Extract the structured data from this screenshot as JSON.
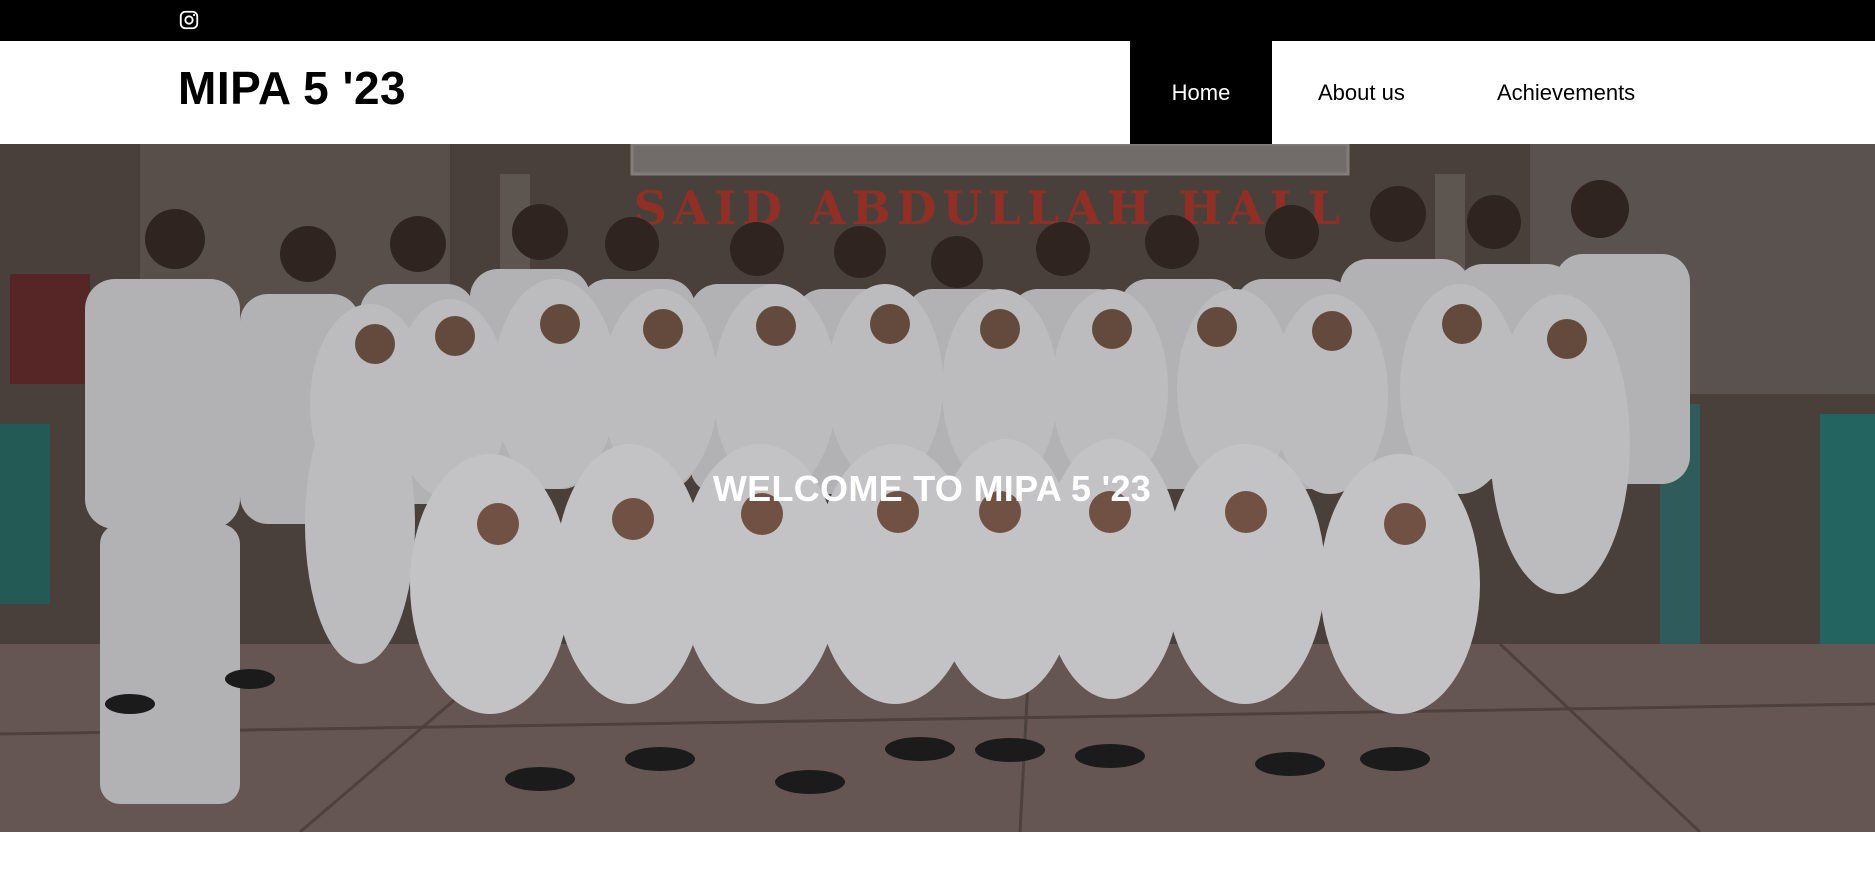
{
  "topbar": {
    "social_icon": "instagram-icon",
    "background": "#000000"
  },
  "header": {
    "brand": "MIPA 5 '23",
    "nav": [
      {
        "label": "Home",
        "active": true
      },
      {
        "label": "About us",
        "active": false
      },
      {
        "label": "Achievements",
        "active": false
      }
    ]
  },
  "hero": {
    "title": "WELCOME TO MIPA 5 '23",
    "banner_text": "SAID ABDULLAH HALL",
    "image": "class-group-photo"
  },
  "colors": {
    "topbar": "#000000",
    "active_nav_bg": "#000000",
    "active_nav_text": "#ffffff",
    "banner_text": "#c0392b"
  }
}
